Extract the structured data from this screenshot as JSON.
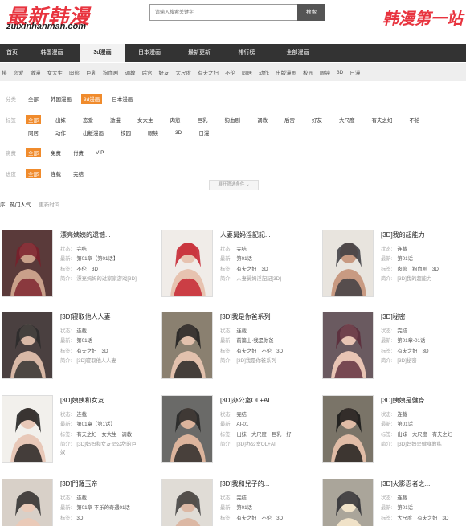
{
  "header": {
    "logo_cn": "最新韩漫",
    "logo_en": "zuixinhanman.com",
    "search_placeholder": "请输入搜索关键字",
    "search_button": "搜索",
    "slogan": "韩漫第一站"
  },
  "mainnav": [
    {
      "label": "首页",
      "w": 30
    },
    {
      "label": "韩国漫画",
      "w": 69
    },
    {
      "label": "3d漫画",
      "w": 57,
      "active": true
    },
    {
      "label": "日本漫画",
      "w": 60
    },
    {
      "label": "最新更新",
      "w": 64
    },
    {
      "label": "排行榜",
      "w": 54
    },
    {
      "label": "全部漫画",
      "w": 73
    }
  ],
  "tagnav": [
    "排",
    "恋爱",
    "激漫",
    "女大生",
    "肉慾",
    "巨乳",
    "狗血剧",
    "调教",
    "后宫",
    "好友",
    "大尺度",
    "有夫之妇",
    "不伦",
    "同居",
    "动作",
    "出版漫画",
    "校园",
    "眼镜",
    "3D",
    "日漫"
  ],
  "filter": {
    "category": {
      "label": "分类",
      "options": [
        "全部",
        "韩国漫画",
        "3d漫画",
        "日本漫画"
      ],
      "selected": 2
    },
    "tags": {
      "label": "标签",
      "options": [
        "全部",
        "出妹",
        "恋爱",
        "激漫",
        "女大生",
        "肉慾",
        "巨乳",
        "狗血剧",
        "调教",
        "后宫",
        "好友",
        "大尺度",
        "有夫之妇",
        "不伦",
        "同居",
        "动作",
        "出版漫画",
        "校园",
        "眼镜",
        "3D",
        "日漫"
      ],
      "selected": 0
    },
    "pay": {
      "label": "资费",
      "options": [
        "全部",
        "免费",
        "付费",
        "VIP"
      ],
      "selected": 0
    },
    "progress": {
      "label": "进度",
      "options": [
        "全部",
        "连载",
        "完结"
      ],
      "selected": 0
    },
    "more_button": "展开筛选条件"
  },
  "sort": {
    "prefix": "序:",
    "hot": "热门人气",
    "recent": "更新时间"
  },
  "cards": [
    {
      "title": "漂亮姨姨的遗憾...",
      "status_label": "状态:",
      "status": "完结",
      "latest_label": "最新:",
      "latest": "第01章【第01话】",
      "tags_label": "标签:",
      "tags": [
        "不伦",
        "3D"
      ],
      "intro_label": "简介:",
      "intro": "漂亮妈妈的过家家游戏[3D]"
    },
    {
      "title": "人妻舅妈淫記記...",
      "status_label": "状态:",
      "status": "完结",
      "latest_label": "最新:",
      "latest": "第01话",
      "tags_label": "标签:",
      "tags": [
        "有夫之妇",
        "3D"
      ],
      "intro_label": "简介:",
      "intro": "人妻舅妈淫記記[3D]"
    },
    {
      "title": "[3D]我的超能力",
      "status_label": "状态:",
      "status": "连载",
      "latest_label": "最新:",
      "latest": "第01话",
      "tags_label": "标签:",
      "tags": [
        "肉慾",
        "狗血剧",
        "3D"
      ],
      "intro_label": "简介:",
      "intro": "[3D]我的超能力"
    },
    {
      "title": "[3D]寝取他人人妻",
      "status_label": "状态:",
      "status": "连载",
      "latest_label": "最新:",
      "latest": "第01话",
      "tags_label": "标签:",
      "tags": [
        "有夫之妇",
        "3D"
      ],
      "intro_label": "简介:",
      "intro": "[3D]寝取他人人妻"
    },
    {
      "title": "[3D]我是你爸系列",
      "status_label": "状态:",
      "status": "连载",
      "latest_label": "最新:",
      "latest": "前篇上·我是你爸",
      "tags_label": "标签:",
      "tags": [
        "有夫之妇",
        "不伦",
        "3D"
      ],
      "intro_label": "简介:",
      "intro": "[3D]我是你爸系列"
    },
    {
      "title": "[3D]秘密",
      "status_label": "状态:",
      "status": "完结",
      "latest_label": "最新:",
      "latest": "第01章-01话",
      "tags_label": "标签:",
      "tags": [
        "有夫之妇",
        "3D"
      ],
      "intro_label": "简介:",
      "intro": "[3D]秘密"
    },
    {
      "title": "[3D]姨姨和女友...",
      "status_label": "状态:",
      "status": "连载",
      "latest_label": "最新:",
      "latest": "第01章【第1话】",
      "tags_label": "标签:",
      "tags": [
        "有夫之妇",
        "女大生",
        "调教"
      ],
      "intro_label": "简介:",
      "intro": "[3D]妈妈和女友是公敌的巨奴"
    },
    {
      "title": "[3D]办公室OL+AI",
      "status_label": "状态:",
      "status": "完结",
      "latest_label": "最新:",
      "latest": "AI-01",
      "tags_label": "标签:",
      "tags": [
        "出妹",
        "大尺度",
        "巨乳",
        "好"
      ],
      "intro_label": "简介:",
      "intro": "[3D]办公室OL+AI"
    },
    {
      "title": "[3D]姨姨是健身...",
      "status_label": "状态:",
      "status": "连载",
      "latest_label": "最新:",
      "latest": "第01话",
      "tags_label": "标签:",
      "tags": [
        "出妹",
        "大尺度",
        "有夫之妇"
      ],
      "intro_label": "简介:",
      "intro": "[3D]妈妈是健身教练"
    },
    {
      "title": "[3D]門羅玉帝",
      "status_label": "状态:",
      "status": "连载",
      "latest_label": "最新:",
      "latest": "第01章·不乐的奇遇01话",
      "tags_label": "标签:",
      "tags": [
        "3D"
      ],
      "intro_label": "",
      "intro": ""
    },
    {
      "title": "[3D]我和兒子的...",
      "status_label": "状态:",
      "status": "完结",
      "latest_label": "最新:",
      "latest": "第01话",
      "tags_label": "标签:",
      "tags": [
        "有夫之妇",
        "不伦",
        "3D"
      ],
      "intro_label": "",
      "intro": ""
    },
    {
      "title": "[3D]火影忍者之...",
      "status_label": "状态:",
      "status": "连载",
      "latest_label": "最新:",
      "latest": "第01话",
      "tags_label": "标签:",
      "tags": [
        "大尺度",
        "有夫之妇",
        "3D"
      ],
      "intro_label": "",
      "intro": ""
    }
  ],
  "colors": {
    "brand_red": "#e8343f",
    "nav_dark": "#333333",
    "filter_orange": "#f08b2c"
  }
}
